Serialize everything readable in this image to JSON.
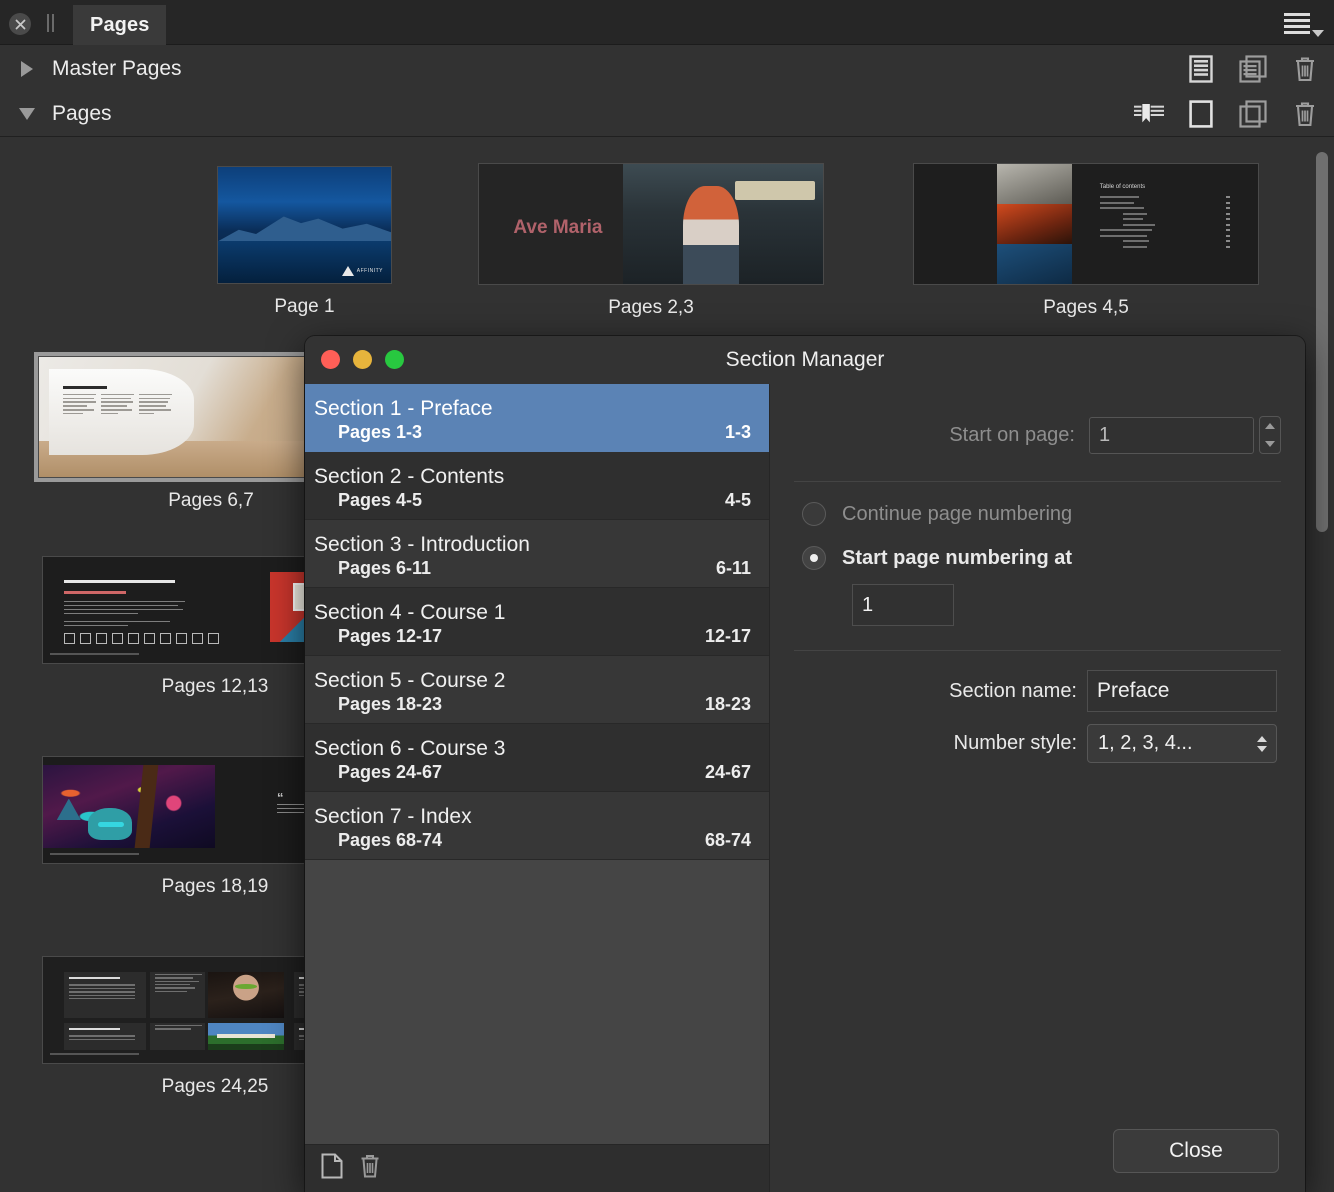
{
  "panel": {
    "tab_label": "Pages",
    "close_icon": "close-circle-icon",
    "grip_icon": "drag-grip-icon",
    "menu_icon": "hamburger-menu-icon",
    "groups": [
      {
        "label": "Master Pages",
        "expanded": false,
        "disclosure_icon": "triangle-right-icon"
      },
      {
        "label": "Pages",
        "expanded": true,
        "disclosure_icon": "triangle-down-icon"
      }
    ],
    "master_tools": [
      "master-page-icon",
      "duplicate-master-icon",
      "delete-master-icon"
    ],
    "page_tools": [
      "section-marker-icon",
      "add-page-icon",
      "duplicate-page-icon",
      "delete-page-icon"
    ]
  },
  "thumbnails": [
    {
      "caption": "Page 1",
      "kind": "cover",
      "selected": false
    },
    {
      "caption": "Pages 2,3",
      "kind": "avemaria",
      "selected": false
    },
    {
      "caption": "Pages 4,5",
      "kind": "contents",
      "selected": false
    },
    {
      "caption": "Pages 6,7",
      "kind": "story",
      "selected": true
    },
    {
      "caption": "Pages 12,13",
      "kind": "software",
      "selected": false
    },
    {
      "caption": "Pages 18,19",
      "kind": "monster",
      "selected": false
    },
    {
      "caption": "Pages 24,25",
      "kind": "grid",
      "selected": false
    }
  ],
  "thumb_art": {
    "avemaria_text": "Ave Maria",
    "contents_heading": "Table of contents",
    "story_heading": "Our story so far",
    "software_heading": "The best graphic design software available",
    "software_sub": "For complete graphic design control"
  },
  "dialog": {
    "title": "Section Manager",
    "traffic_lights": [
      "close-window-button",
      "minimize-window-button",
      "zoom-window-button"
    ],
    "sections": [
      {
        "title": "Section 1 - Preface",
        "pages_label": "Pages 1-3",
        "range": "1-3",
        "selected": true
      },
      {
        "title": "Section 2 - Contents",
        "pages_label": "Pages 4-5",
        "range": "4-5",
        "selected": false
      },
      {
        "title": "Section 3 - Introduction",
        "pages_label": "Pages 6-11",
        "range": "6-11",
        "selected": false
      },
      {
        "title": "Section 4 - Course 1",
        "pages_label": "Pages 12-17",
        "range": "12-17",
        "selected": false
      },
      {
        "title": "Section 5 - Course 2",
        "pages_label": "Pages 18-23",
        "range": "18-23",
        "selected": false
      },
      {
        "title": "Section 6 - Course 3",
        "pages_label": "Pages 24-67",
        "range": "24-67",
        "selected": false
      },
      {
        "title": "Section 7 - Index",
        "pages_label": "Pages 68-74",
        "range": "68-74",
        "selected": false
      }
    ],
    "list_footer": {
      "add_icon": "new-section-icon",
      "delete_icon": "delete-section-icon"
    },
    "detail": {
      "start_on_page_label": "Start on page:",
      "start_on_page_value": "1",
      "start_on_page_disabled": true,
      "continue_numbering_label": "Continue page numbering",
      "continue_numbering_selected": false,
      "start_numbering_label": "Start page numbering at",
      "start_numbering_selected": true,
      "start_numbering_value": "1",
      "section_name_label": "Section name:",
      "section_name_value": "Preface",
      "number_style_label": "Number style:",
      "number_style_value": "1, 2, 3, 4..."
    },
    "close_label": "Close"
  },
  "colors": {
    "selection_blue": "#5b83b5",
    "panel_bg": "#323232",
    "dialog_bg": "#333333",
    "list_bg": "#454545"
  }
}
